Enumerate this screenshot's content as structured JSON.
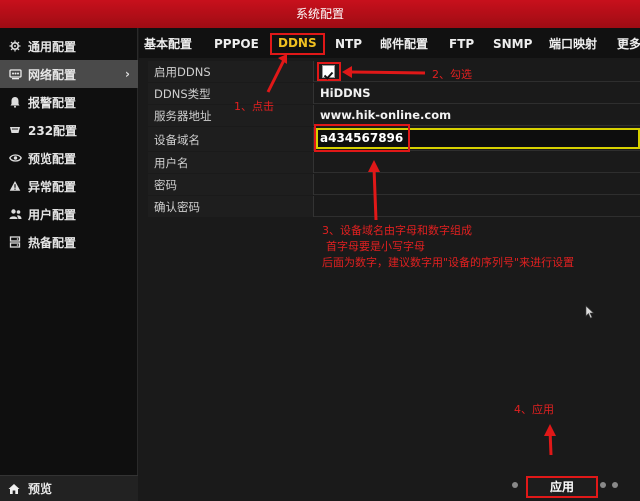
{
  "window": {
    "title": "系统配置"
  },
  "sidebar": {
    "items": [
      {
        "label": "通用配置",
        "icon": "gear-icon"
      },
      {
        "label": "网络配置",
        "icon": "network-icon",
        "active": true
      },
      {
        "label": "报警配置",
        "icon": "alarm-icon"
      },
      {
        "label": "232配置",
        "icon": "serial-icon"
      },
      {
        "label": "预览配置",
        "icon": "eye-icon"
      },
      {
        "label": "异常配置",
        "icon": "warning-icon"
      },
      {
        "label": "用户配置",
        "icon": "users-icon"
      },
      {
        "label": "热备配置",
        "icon": "hotspare-icon"
      }
    ],
    "bottom": {
      "label": "预览",
      "icon": "home-icon"
    }
  },
  "tabs": [
    {
      "label": "基本配置"
    },
    {
      "label": "PPPOE"
    },
    {
      "label": "DDNS",
      "active": true
    },
    {
      "label": "NTP"
    },
    {
      "label": "邮件配置"
    },
    {
      "label": "FTP"
    },
    {
      "label": "SNMP"
    },
    {
      "label": "端口映射"
    },
    {
      "label": "更多"
    }
  ],
  "form": {
    "enable_ddns": {
      "label": "启用DDNS",
      "checked": true
    },
    "ddns_type": {
      "label": "DDNS类型",
      "value": "HiDDNS"
    },
    "server_address": {
      "label": "服务器地址",
      "value": "www.hik-online.com"
    },
    "device_domain": {
      "label": "设备域名",
      "value": "a434567896"
    },
    "username": {
      "label": "用户名",
      "value": ""
    },
    "password": {
      "label": "密码",
      "value": ""
    },
    "confirm_password": {
      "label": "确认密码",
      "value": ""
    }
  },
  "annotations": {
    "a1": "1、点击",
    "a2": "2、勾选",
    "a3_line1": "3、设备域名由字母和数字组成",
    "a3_line2": "首字母要是小写字母",
    "a3_line3": "后面为数字，建议数字用\"设备的序列号\"来进行设置",
    "a4": "4、应用"
  },
  "footer": {
    "apply_label": "应用"
  },
  "colors": {
    "accent_red": "#e01818",
    "title_red": "#b50e18",
    "tab_active": "#f0c020",
    "input_border": "#d6d000"
  }
}
